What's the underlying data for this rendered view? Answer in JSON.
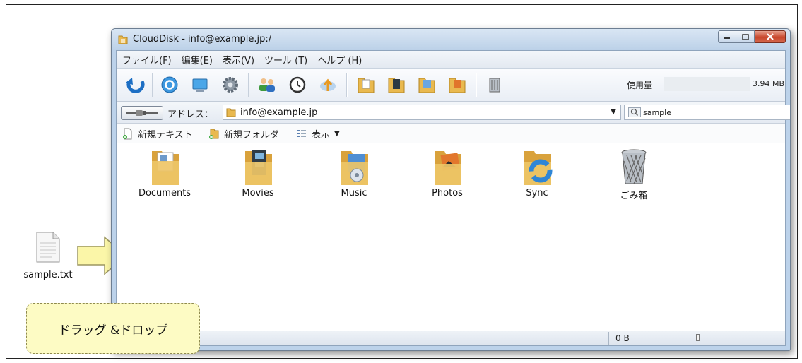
{
  "window": {
    "title": "CloudDisk - info@example.jp:/",
    "buttons": {
      "minimize": "minimize",
      "maximize": "maximize",
      "close": "close"
    }
  },
  "menu": [
    {
      "label": "ファイル(F)"
    },
    {
      "label": "編集(E)"
    },
    {
      "label": "表示(V)"
    },
    {
      "label": "ツール (T)"
    },
    {
      "label": "ヘルプ (H)"
    }
  ],
  "toolbar": {
    "icons": [
      "refresh-icon",
      "sync-circle-icon",
      "monitor-icon",
      "settings-gear-icon",
      "users-icon",
      "clock-icon",
      "upload-cloud-icon",
      "documents-folder-icon",
      "movies-folder-icon",
      "music-folder-icon",
      "photos-folder-icon",
      "trash-icon"
    ],
    "usage_label": "使用量",
    "usage_value": "3.94 MB"
  },
  "address": {
    "label": "アドレス：",
    "value": "info@example.jp",
    "search_value": "sample"
  },
  "actions": {
    "new_text": "新規テキスト",
    "new_folder": "新規フォルダ",
    "view": "表示"
  },
  "files": [
    {
      "name": "Documents",
      "icon": "documents-folder-icon"
    },
    {
      "name": "Movies",
      "icon": "movies-folder-icon"
    },
    {
      "name": "Music",
      "icon": "music-folder-icon"
    },
    {
      "name": "Photos",
      "icon": "photos-folder-icon"
    },
    {
      "name": "Sync",
      "icon": "sync-folder-icon"
    },
    {
      "name": "ごみ箱",
      "icon": "trash-icon"
    }
  ],
  "status": {
    "size": "0 B"
  },
  "desktop_file": {
    "name": "sample.txt"
  },
  "callout": {
    "text": "ドラッグ &ドロップ"
  },
  "colors": {
    "folder": "#e9b94f",
    "callout_bg": "#fdfbc4",
    "arrow_fill": "#fbf6a8",
    "close_button": "#c8452a"
  }
}
